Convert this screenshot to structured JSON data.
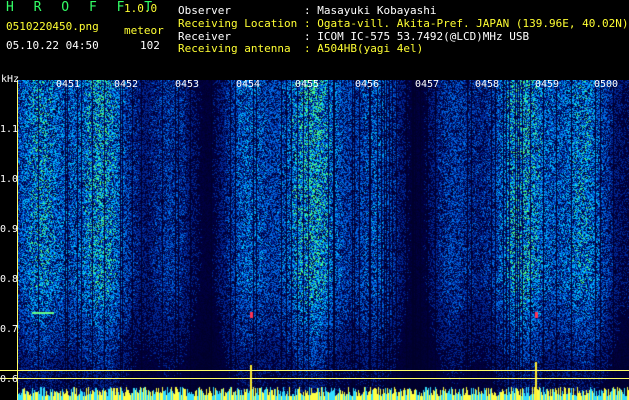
{
  "header": {
    "title": "H R O F F T",
    "version": "1.0.0",
    "file": "0510220450.png",
    "mode": "meteor",
    "datetime": "05.10.22 04:50",
    "count": "102"
  },
  "info": [
    {
      "label": "Observer",
      "value": ": Masayuki Kobayashi"
    },
    {
      "label": "Receiving Location",
      "value": ": Ogata-vill. Akita-Pref. JAPAN (139.96E, 40.02N)"
    },
    {
      "label": "Receiver",
      "value": ": ICOM IC-575 53.7492(@LCD)MHz USB"
    },
    {
      "label": "Receiving antenna",
      "value": ": A504HB(yagi 4el)"
    }
  ],
  "axis": {
    "y_unit": "kHz",
    "y_ticks": [
      "1.1",
      "1.0",
      "0.9",
      "0.8",
      "0.7",
      "0.6"
    ],
    "x_ticks": [
      "0451",
      "0452",
      "0453",
      "0454",
      "0455",
      "0456",
      "0457",
      "0458",
      "0459",
      "0500"
    ]
  },
  "colors": {
    "background": "#000000",
    "header_white": "#ffffff",
    "header_yellow": "#ffff33",
    "title_green": "#33ff66"
  }
}
